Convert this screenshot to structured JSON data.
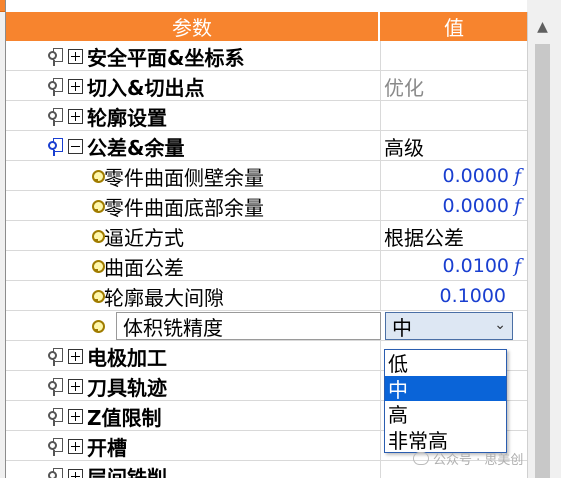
{
  "header": {
    "param_label": "参数",
    "value_label": "值"
  },
  "rows": [
    {
      "label": "安全平面&坐标系",
      "value": ""
    },
    {
      "label": "切入&切出点",
      "value": "优化"
    },
    {
      "label": "轮廓设置",
      "value": ""
    },
    {
      "label": "公差&余量",
      "value": "高级"
    },
    {
      "label": "零件曲面侧壁余量",
      "value": "0.0000"
    },
    {
      "label": "零件曲面底部余量",
      "value": "0.0000"
    },
    {
      "label": "逼近方式",
      "value": "根据公差"
    },
    {
      "label": "曲面公差",
      "value": "0.0100"
    },
    {
      "label": "轮廓最大间隙",
      "value": "0.1000"
    },
    {
      "label": "体积铣精度",
      "value": "中"
    },
    {
      "label": "电极加工",
      "value": ""
    },
    {
      "label": "刀具轨迹",
      "value": ""
    },
    {
      "label": "Z值限制",
      "value": ""
    },
    {
      "label": "开槽",
      "value": ""
    },
    {
      "label": "层间铣削",
      "value": ""
    }
  ],
  "function_marker": "f",
  "dropdown": {
    "options": [
      "低",
      "中",
      "高",
      "非常高"
    ],
    "selected_index": 1
  },
  "watermark": "公众号 · 思美创",
  "colors": {
    "header_bg": "#f7842e",
    "numeric_text": "#1a3fd0",
    "selection": "#0a64d8"
  },
  "icons": [
    "group-key-icon",
    "expand-plus-icon",
    "collapse-minus-icon",
    "bulb-icon",
    "chevron-down-icon",
    "scroll-up-arrow-icon",
    "function-icon"
  ]
}
